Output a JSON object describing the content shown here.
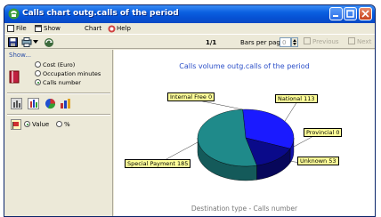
{
  "window": {
    "title": "Calls chart outg.calls of the period"
  },
  "menu": {
    "file": "File",
    "show": "Show",
    "chart": "Chart",
    "help": "Help"
  },
  "toolbar": {
    "page_indicator": "1/1",
    "bars_per_page_label": "Bars per page",
    "bars_per_page_value": "0",
    "previous": "Previous",
    "next": "Next"
  },
  "show_panel": {
    "label": "Show...",
    "options": [
      {
        "label": "Cost (Euro)",
        "selected": false
      },
      {
        "label": "Occupation minutes",
        "selected": false
      },
      {
        "label": "Calls number",
        "selected": true
      }
    ],
    "value_mode": [
      {
        "label": "Value",
        "selected": true
      },
      {
        "label": "%",
        "selected": false
      }
    ]
  },
  "icons": {
    "app": "phone-icon",
    "save": "save-icon",
    "print": "print-icon",
    "refresh": "refresh-icon",
    "book": "book-icon",
    "bar_chart_2d": "bar-chart-icon",
    "bar_chart_3d": "bar-chart-3d-icon",
    "pie_chart": "pie-chart-icon",
    "area_chart": "area-chart-icon",
    "flag": "flag-icon"
  },
  "chart_data": {
    "type": "pie",
    "title": "Calls volume outg.calls of the period",
    "footer": "Destination type - Calls number",
    "categories": [
      "Internal Free",
      "National",
      "Provincial",
      "Unknown",
      "Special Payment"
    ],
    "values": [
      0,
      113,
      0,
      53,
      185
    ],
    "labels": [
      "Internal Free 0",
      "National 113",
      "Provincial 0",
      "Unknown 53",
      "Special Payment 185"
    ],
    "colors": [
      "#1a1aff",
      "#1a1aff",
      "#0000c0",
      "#0a0a8a",
      "#1f8a8a"
    ]
  }
}
